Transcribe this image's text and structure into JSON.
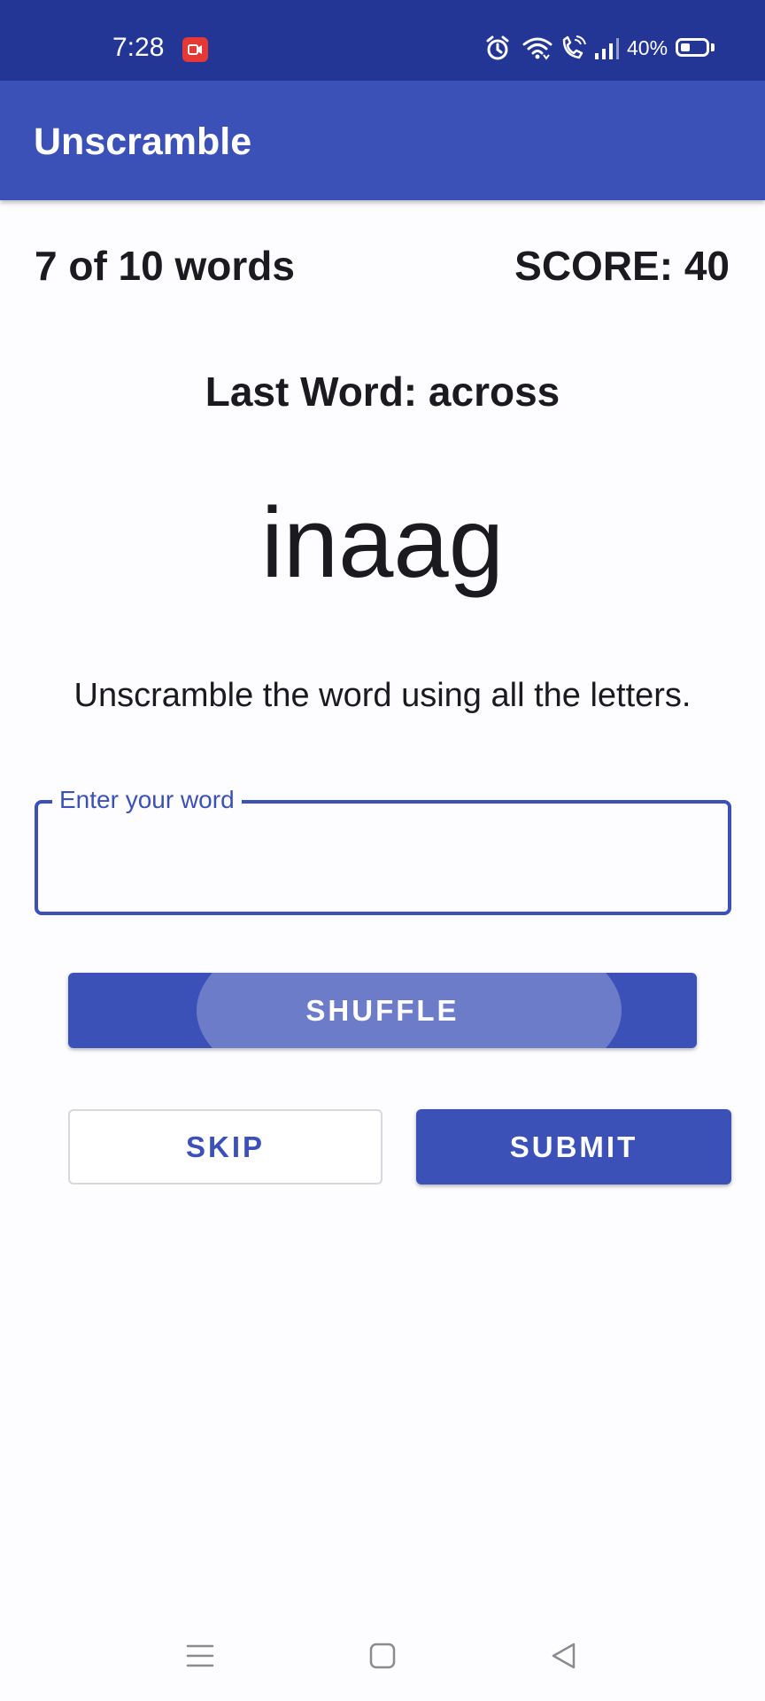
{
  "status_bar": {
    "time": "7:28",
    "battery_percent": "40%",
    "battery_level": 0.4,
    "icons": [
      "screen-record-icon",
      "alarm-icon",
      "wifi-icon",
      "wifi-call-icon",
      "signal-icon",
      "battery-icon"
    ]
  },
  "app_bar": {
    "title": "Unscramble"
  },
  "game": {
    "word_count": "7 of 10 words",
    "score": "SCORE: 40",
    "last_word": "Last Word: across",
    "scrambled_word": "inaag",
    "instructions": "Unscramble the word using all the letters."
  },
  "input": {
    "label": "Enter your word",
    "value": ""
  },
  "buttons": {
    "shuffle": "SHUFFLE",
    "skip": "SKIP",
    "submit": "SUBMIT"
  },
  "nav_bar": {
    "icons": [
      "menu-icon",
      "home-icon",
      "back-icon"
    ]
  },
  "colors": {
    "status_bar": "#233695",
    "primary": "#3c51b7",
    "background": "#fdfcff"
  }
}
